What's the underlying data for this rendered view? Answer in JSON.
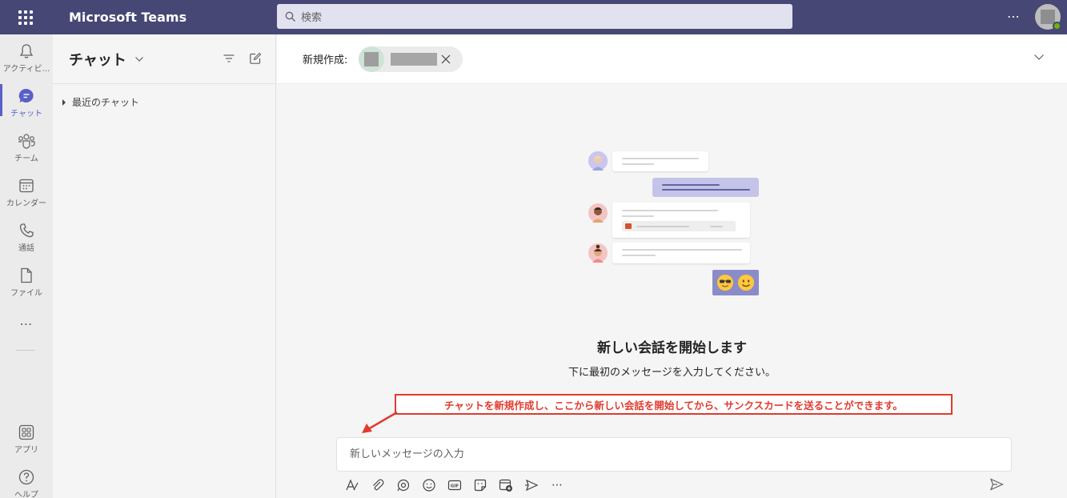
{
  "app": {
    "title": "Microsoft Teams",
    "more": "⋯"
  },
  "search": {
    "placeholder": "検索"
  },
  "rail": {
    "items": [
      {
        "label": "アクティビ...",
        "icon": "bell-icon"
      },
      {
        "label": "チャット",
        "icon": "chat-icon",
        "active": true
      },
      {
        "label": "チーム",
        "icon": "teams-icon"
      },
      {
        "label": "カレンダー",
        "icon": "calendar-icon"
      },
      {
        "label": "通話",
        "icon": "phone-icon"
      },
      {
        "label": "ファイル",
        "icon": "file-icon"
      }
    ],
    "more": "⋯",
    "apps_label": "アプリ",
    "help_label": "ヘルプ"
  },
  "chatlist": {
    "title": "チャット",
    "section_label": "最近のチャット"
  },
  "main": {
    "new_label": "新規作成:",
    "empty_title": "新しい会話を開始します",
    "empty_subtitle": "下に最初のメッセージを入力してください。",
    "annotation": "チャットを新規作成し、ここから新しい会話を開始してから、サンクスカードを送ることができます。",
    "composer_placeholder": "新しいメッセージの入力",
    "toolbar_more": "⋯"
  },
  "colors": {
    "topbar": "#464775",
    "accent": "#5b5fc7",
    "annotation": "#e03b2e"
  }
}
